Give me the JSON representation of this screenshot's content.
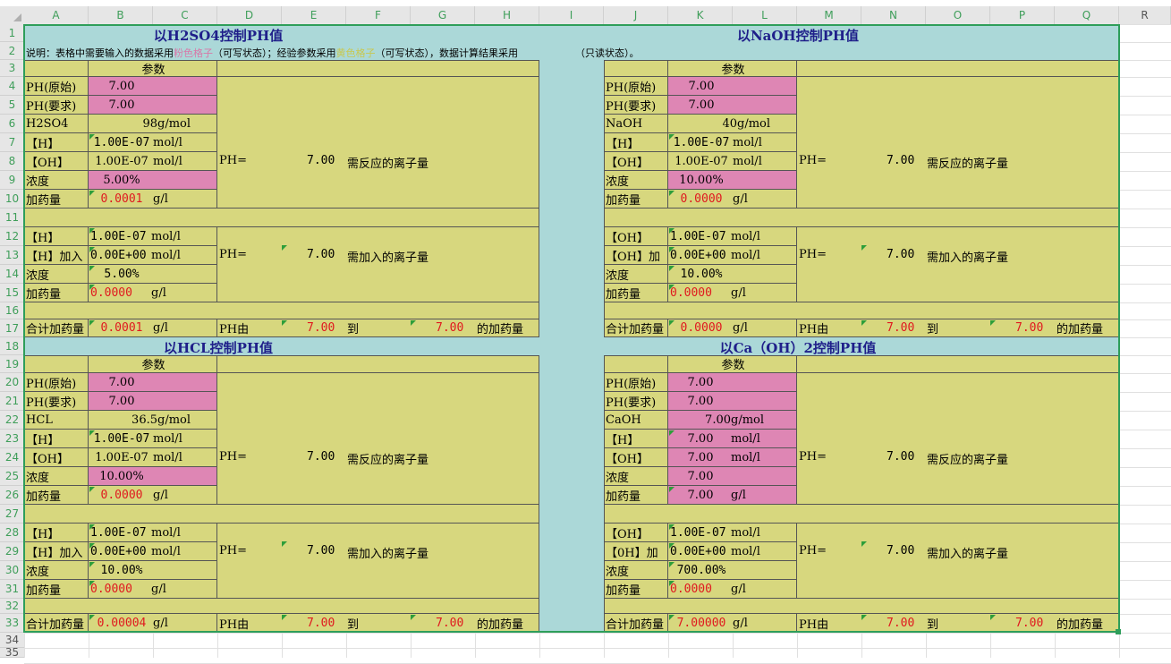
{
  "columns": [
    "A",
    "B",
    "C",
    "D",
    "E",
    "F",
    "G",
    "H",
    "I",
    "J",
    "K",
    "L",
    "M",
    "N",
    "O",
    "P",
    "Q",
    "R"
  ],
  "rows": [
    "1",
    "2",
    "3",
    "4",
    "5",
    "6",
    "7",
    "8",
    "9",
    "10",
    "11",
    "12",
    "13",
    "14",
    "15",
    "16",
    "17",
    "18",
    "19",
    "20",
    "21",
    "22",
    "23",
    "24",
    "25",
    "26",
    "27",
    "28",
    "29",
    "30",
    "31",
    "32",
    "33",
    "34",
    "35"
  ],
  "titles": {
    "h2so4": "以H2SO4控制PH值",
    "naoh": "以NaOH控制PH值",
    "hcl": "以HCL控制PH值",
    "caoh": "以Ca（OH）2控制PH值"
  },
  "note": {
    "prefix": "说明：表格中需要输入的数据采用",
    "pink": "粉色格子",
    "mid1": "（可写状态）；经验参数采用",
    "yellow": "黄色格子",
    "mid2": "（可写状态），数据计算结果采用",
    "tail": "（只读状态）。"
  },
  "labels": {
    "param": "参数",
    "ph_orig": "PH(原始)",
    "ph_req": "PH(要求)",
    "h": "【H】",
    "oh": "【OH】",
    "conc": "浓度",
    "dose": "加药量",
    "h_add": "【H】加入",
    "oh_add": "【OH】加",
    "oh_add2": "【0H】加",
    "oh2": "【0H】",
    "total": "合计加药量",
    "ph_eq": "PH=",
    "need_react": "需反应的离子量",
    "need_add": "需加入的离子量",
    "ph_from": "PH由",
    "to": "到",
    "dose_of": "的加药量",
    "gl": "g/l",
    "moll": "mol/l",
    "gmol": "g/mol"
  },
  "h2so4": {
    "ph_orig": "7.00",
    "ph_req": "7.00",
    "chem": "H2SO4",
    "mw": "98",
    "h": "1.00E-07",
    "oh": "1.00E-07",
    "ph": "7.00",
    "conc": "5.00%",
    "dose": "0.0001",
    "h2": "1.00E-07",
    "hadd": "0.00E+00",
    "conc2": "5.00%",
    "dose2": "0.0000",
    "ph2": "7.00",
    "total": "0.0001",
    "from": "7.00",
    "to": "7.00"
  },
  "naoh": {
    "ph_orig": "7.00",
    "ph_req": "7.00",
    "chem": "NaOH",
    "mw": "40",
    "h": "1.00E-07",
    "oh": "1.00E-07",
    "ph": "7.00",
    "conc": "10.00%",
    "dose": "0.0000",
    "oh2": "1.00E-07",
    "ohadd": "0.00E+00",
    "conc2": "10.00%",
    "dose2": "0.0000",
    "ph2": "7.00",
    "total": "0.0000",
    "from": "7.00",
    "to": "7.00"
  },
  "hcl": {
    "ph_orig": "7.00",
    "ph_req": "7.00",
    "chem": "HCL",
    "mw": "36.5",
    "h": "1.00E-07",
    "oh": "1.00E-07",
    "ph": "7.00",
    "conc": "10.00%",
    "dose": "0.0000",
    "h2": "1.00E-07",
    "hadd": "0.00E+00",
    "conc2": "10.00%",
    "dose2": "0.0000",
    "ph2": "7.00",
    "total": "0.00004",
    "from": "7.00",
    "to": "7.00"
  },
  "caoh": {
    "ph_orig": "7.00",
    "ph_req": "7.00",
    "chem": "CaOH",
    "mw": "7.00",
    "h": "7.00",
    "oh": "7.00",
    "ph": "7.00",
    "conc": "7.00",
    "dose": "7.00",
    "oh2": "1.00E-07",
    "ohadd": "0.00E+00",
    "conc2": "700.00%",
    "dose2": "0.0000",
    "ph2": "7.00",
    "total": "7.00000",
    "from": "7.00",
    "to": "7.00"
  }
}
